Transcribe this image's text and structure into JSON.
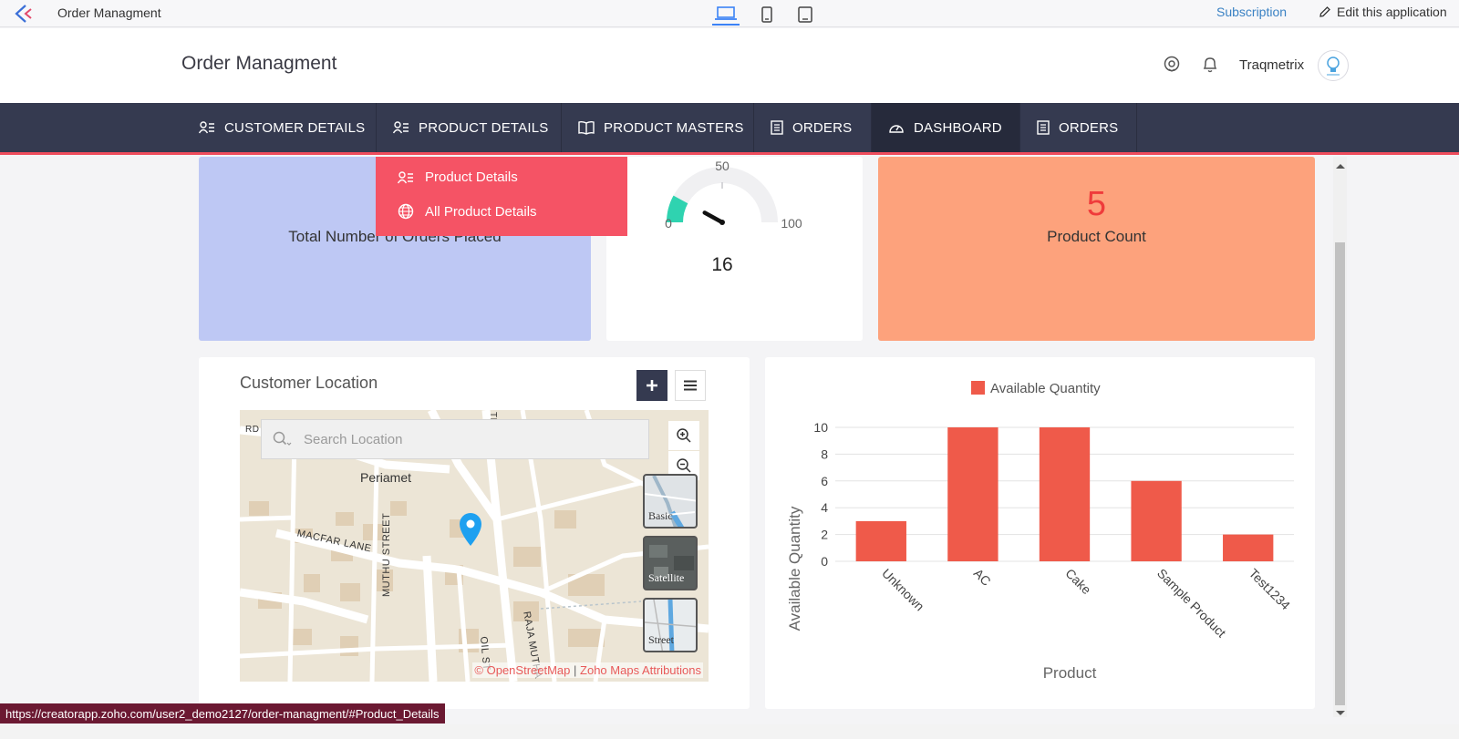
{
  "topbar": {
    "app_title": "Order Managment",
    "subscription": "Subscription",
    "edit_app": "Edit this application"
  },
  "header": {
    "title": "Order Managment",
    "user": "Traqmetrix"
  },
  "nav": {
    "items": [
      {
        "label": "CUSTOMER DETAILS"
      },
      {
        "label": "PRODUCT DETAILS"
      },
      {
        "label": "PRODUCT MASTERS"
      },
      {
        "label": "ORDERS"
      },
      {
        "label": "DASHBOARD"
      },
      {
        "label": "ORDERS"
      }
    ]
  },
  "dropdown": {
    "items": [
      {
        "label": "Product Details"
      },
      {
        "label": "All Product Details"
      }
    ]
  },
  "cards": {
    "orders_label": "Total Number of Orders Placed",
    "gauge": {
      "min": "0",
      "mid": "50",
      "max": "100",
      "value": "16",
      "value_num": 16
    },
    "product_count": "5",
    "product_label": "Product Count"
  },
  "map": {
    "title": "Customer Location",
    "search_placeholder": "Search Location",
    "layers": [
      "Basic",
      "Satellite",
      "Street"
    ],
    "labels": [
      "Periamet",
      "MACFAR LANE",
      "MUTHU STREET",
      "RAJA MUTHA",
      "OIL ST",
      "RD",
      "TH"
    ],
    "attr_osm": "© OpenStreetMap",
    "attr_sep": "|",
    "attr_zoho": "Zoho Maps Attributions"
  },
  "chart_data": {
    "type": "bar",
    "categories": [
      "Unknown",
      "AC",
      "Cake",
      "Sample Product",
      "Test1234"
    ],
    "series": [
      {
        "name": "Available Quantity",
        "values": [
          3,
          10,
          10,
          6,
          2
        ],
        "color": "#ef5a4a"
      }
    ],
    "xlabel": "Product",
    "ylabel": "Available Quantity",
    "ylim": [
      0,
      10
    ],
    "yticks": [
      0,
      2,
      4,
      6,
      8,
      10
    ],
    "legend": "top-center",
    "grid": true
  },
  "status_url": "https://creatorapp.zoho.com/user2_demo2127/order-managment/#Product_Details"
}
